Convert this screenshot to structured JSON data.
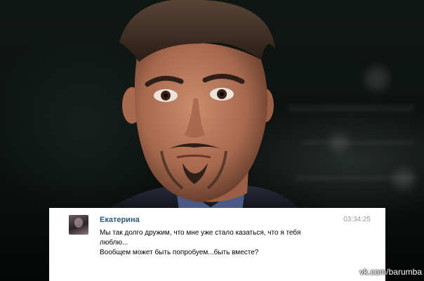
{
  "message": {
    "sender": "Екатерина",
    "timestamp": "03:34:25",
    "lines": [
      "Мы так долго дружим, что мне уже стало казаться, что я тебя",
      "люблю...",
      "Вообщем может быть попробуем...быть вместе?"
    ]
  },
  "watermark": "vk.com/barumba"
}
